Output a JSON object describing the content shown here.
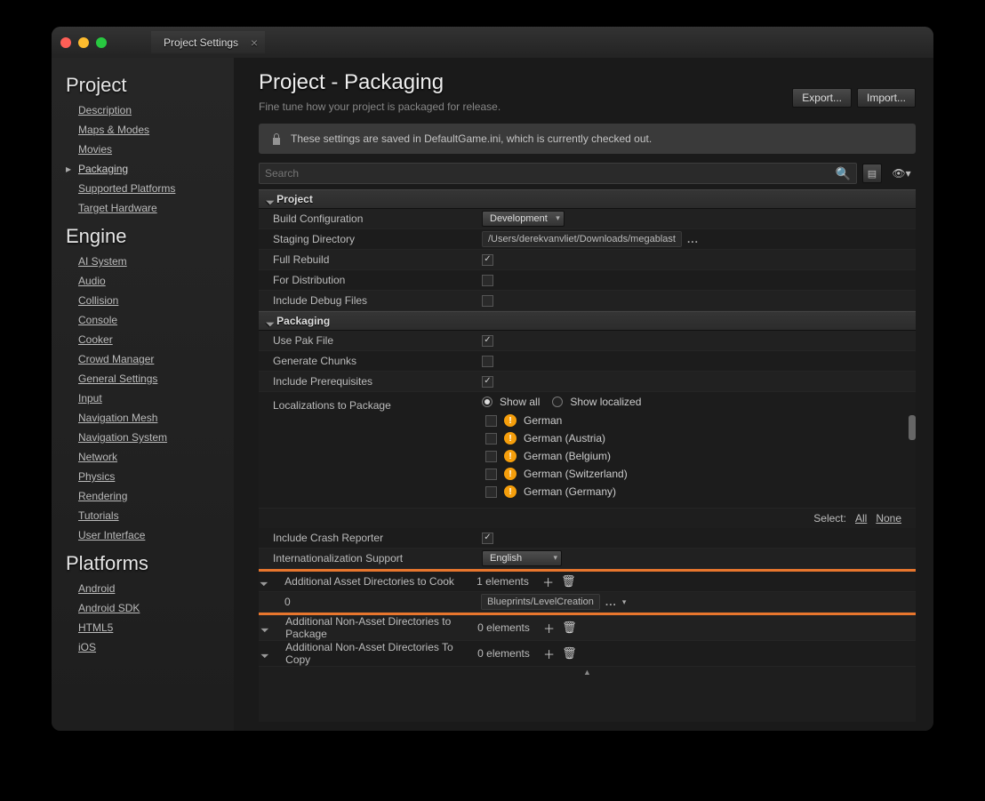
{
  "window": {
    "tab_title": "Project Settings"
  },
  "sidebar": {
    "categories": [
      {
        "name": "Project",
        "items": [
          "Description",
          "Maps & Modes",
          "Movies",
          "Packaging",
          "Supported Platforms",
          "Target Hardware"
        ],
        "active_index": 3
      },
      {
        "name": "Engine",
        "items": [
          "AI System",
          "Audio",
          "Collision",
          "Console",
          "Cooker",
          "Crowd Manager",
          "General Settings",
          "Input",
          "Navigation Mesh",
          "Navigation System",
          "Network",
          "Physics",
          "Rendering",
          "Tutorials",
          "User Interface"
        ]
      },
      {
        "name": "Platforms",
        "items": [
          "Android",
          "Android SDK",
          "HTML5",
          "iOS"
        ]
      }
    ]
  },
  "header": {
    "title": "Project - Packaging",
    "subtitle": "Fine tune how your project is packaged for release.",
    "export_btn": "Export...",
    "import_btn": "Import..."
  },
  "notice": "These settings are saved in DefaultGame.ini, which is currently checked out.",
  "search": {
    "placeholder": "Search"
  },
  "sections": {
    "project": {
      "title": "Project",
      "build_config": {
        "label": "Build Configuration",
        "value": "Development"
      },
      "staging_dir": {
        "label": "Staging Directory",
        "value": "/Users/derekvanvliet/Downloads/megablast"
      },
      "full_rebuild": {
        "label": "Full Rebuild",
        "checked": true
      },
      "for_dist": {
        "label": "For Distribution",
        "checked": false
      },
      "include_debug": {
        "label": "Include Debug Files",
        "checked": false
      }
    },
    "packaging": {
      "title": "Packaging",
      "use_pak": {
        "label": "Use Pak File",
        "checked": true
      },
      "gen_chunks": {
        "label": "Generate Chunks",
        "checked": false
      },
      "include_prereq": {
        "label": "Include Prerequisites",
        "checked": true
      },
      "localizations": {
        "label": "Localizations to Package",
        "show_all": "Show all",
        "show_localized": "Show localized",
        "langs": [
          "German",
          "German (Austria)",
          "German (Belgium)",
          "German (Switzerland)",
          "German (Germany)"
        ],
        "select_label": "Select:",
        "all": "All",
        "none": "None"
      },
      "crash_reporter": {
        "label": "Include Crash Reporter",
        "checked": true
      },
      "i18n": {
        "label": "Internationalization Support",
        "value": "English"
      },
      "extra_cook": {
        "label": "Additional Asset Directories to Cook",
        "count": "1 elements",
        "items": [
          {
            "index": "0",
            "value": "Blueprints/LevelCreation"
          }
        ]
      },
      "extra_pkg": {
        "label": "Additional Non-Asset Directories to Package",
        "count": "0 elements"
      },
      "extra_copy": {
        "label": "Additional Non-Asset Directories To Copy",
        "count": "0 elements"
      }
    }
  }
}
